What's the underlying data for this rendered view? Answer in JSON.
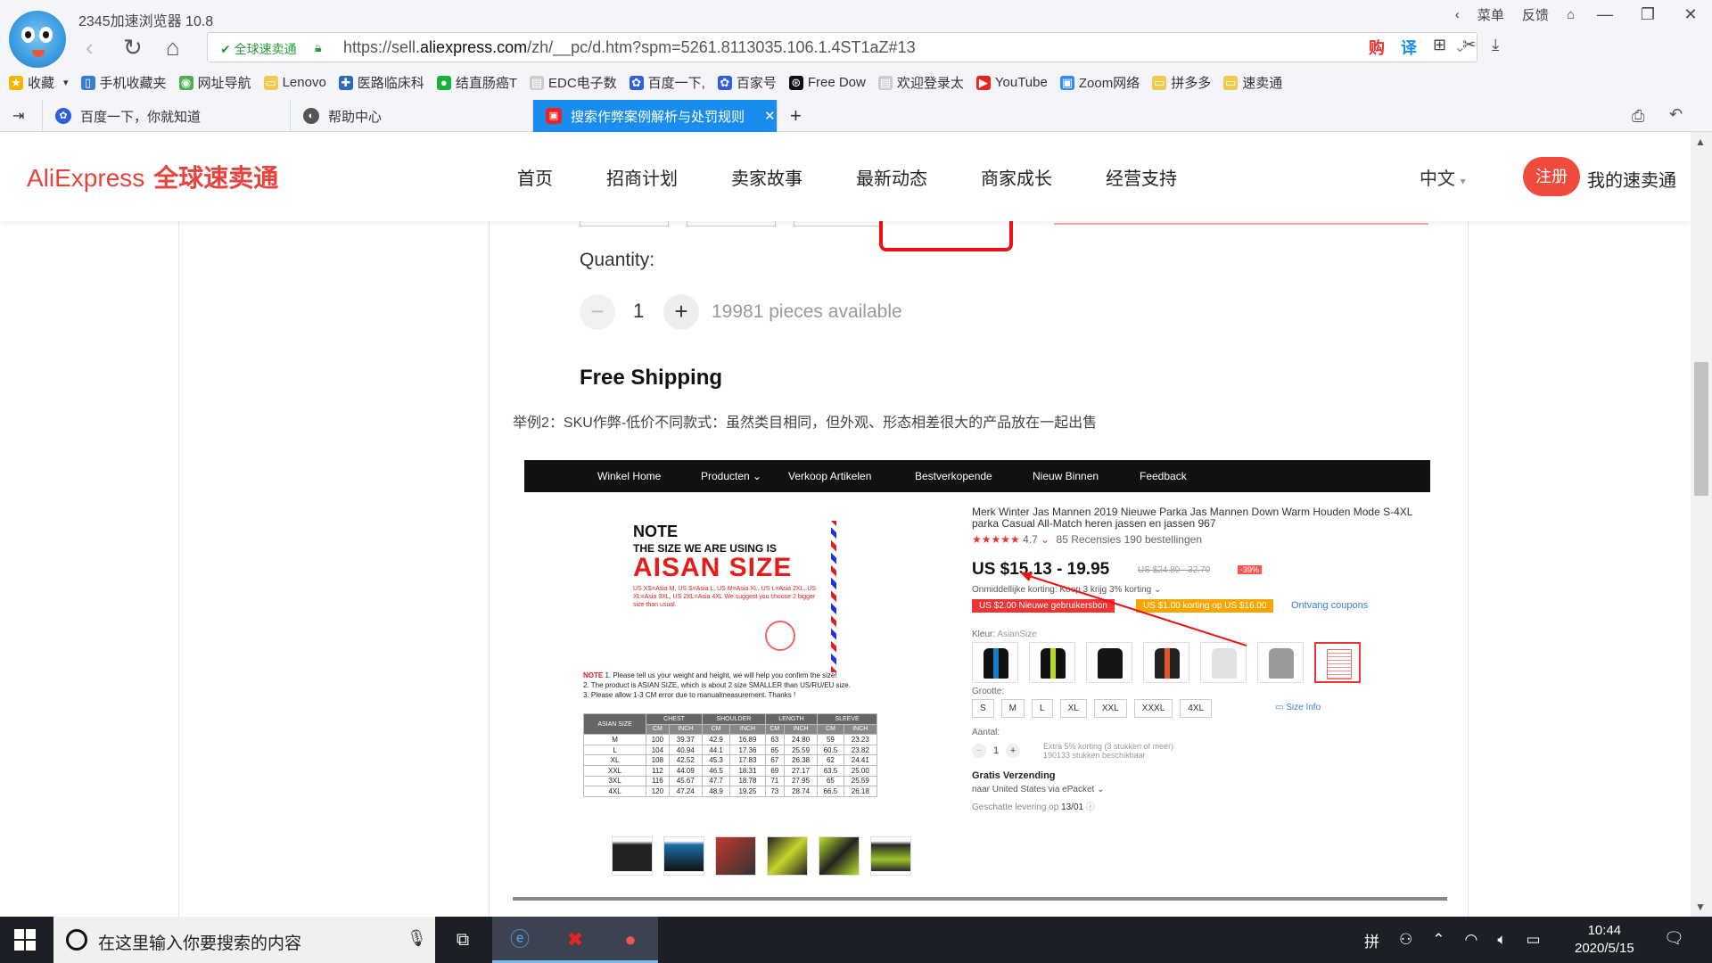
{
  "browser": {
    "title": "2345加速浏览器 10.8",
    "menu_label": "菜单",
    "feedback_label": "反馈",
    "secure_label": "全球速卖通",
    "url_prefix": "https://sell.",
    "url_domain": "aliexpress.com",
    "url_suffix": "/zh/__pc/d.htm?spm=5261.8113035.106.1.4ST1aZ#13",
    "bookmarks": [
      "收藏",
      "手机收藏夹",
      "网址导航",
      "Lenovo",
      "医路临床科",
      "结直肠癌T",
      "EDC电子数",
      "百度一下,",
      "百家号",
      "Free Dow",
      "欢迎登录太",
      "YouTube",
      "Zoom网络",
      "拼多多",
      "速卖通"
    ],
    "tabs": [
      {
        "label": "百度一下，你就知道"
      },
      {
        "label": "帮助中心"
      },
      {
        "label": "搜索作弊案例解析与处罚规则",
        "active": true
      }
    ]
  },
  "site": {
    "logo_en": "AliExpress",
    "logo_cn": "全球速卖通",
    "nav": [
      "首页",
      "招商计划",
      "卖家故事",
      "最新动态",
      "商家成长",
      "经营支持"
    ],
    "lang": "中文",
    "register": "注册",
    "my": "我的速卖通"
  },
  "product_top": {
    "quantity_label": "Quantity:",
    "qty": "1",
    "available": "19981 pieces available",
    "free_shipping": "Free Shipping"
  },
  "example_text": "举例2：SKU作弊-低价不同款式：虽然类目相同，但外观、形态相差很大的产品放在一起出售",
  "inner": {
    "nav": [
      "Winkel Home",
      "Producten ⌄",
      "Verkoop Artikelen",
      "Bestverkopende",
      "Nieuw Binnen",
      "Feedback"
    ],
    "note_title": "NOTE",
    "note_sub": "THE SIZE WE ARE USING IS",
    "note_big": "AISAN SIZE",
    "note_small": "US XS=Asia M, US S=Asia L, US M=Asia XL, US L=Asia 2XL, US XL=Asia 3XL, US 2XL=Asia 4XL We suggest you choose 2 bigger size than usual.",
    "notes_1": "1. Please tell us your weight and height, we will help you confirm the size!",
    "notes_2": "2. The product is ASIAN SIZE, which is about 2 size SMALLER than US/RU/EU size.",
    "notes_3": "3. Please allow 1-3 CM error due to manualmeasurement.  Thanks !",
    "size_table": {
      "headers": [
        "ASIAN SIZE",
        "CHEST",
        "SHOULDER",
        "LENGTH",
        "SLEEVE"
      ],
      "units": [
        "CM",
        "INCH",
        "CM",
        "INCH",
        "CM",
        "INCH",
        "CM",
        "INCH"
      ],
      "rows": [
        [
          "M",
          "100",
          "39.37",
          "42.9",
          "16.89",
          "63",
          "24.80",
          "59",
          "23.23"
        ],
        [
          "L",
          "104",
          "40.94",
          "44.1",
          "17.36",
          "65",
          "25.59",
          "60.5",
          "23.82"
        ],
        [
          "XL",
          "108",
          "42.52",
          "45.3",
          "17.83",
          "67",
          "26.38",
          "62",
          "24.41"
        ],
        [
          "XXL",
          "112",
          "44.09",
          "46.5",
          "18.31",
          "69",
          "27.17",
          "63.5",
          "25.00"
        ],
        [
          "3XL",
          "116",
          "45.67",
          "47.7",
          "18.78",
          "71",
          "27.95",
          "65",
          "25.59"
        ],
        [
          "4XL",
          "120",
          "47.24",
          "48.9",
          "19.25",
          "73",
          "28.74",
          "66.5",
          "26.18"
        ]
      ]
    },
    "title": "Merk Winter Jas Mannen 2019 Nieuwe Parka Jas Mannen Down Warm Houden Mode S-4XL parka Casual All-Match heren jassen en jassen 967",
    "rating": "4.7",
    "reviews": "85 Recensies   190 bestellingen",
    "price": "US $15.13 - 19.95",
    "old_price": "US $24.80 - 32.70",
    "discount": "-39%",
    "instant": "Onmiddellijke korting: Koop 3 krijg 3% korting ⌄",
    "coupon1": "US $2.00 Nieuwe gebruikersbon",
    "coupon2": "US $1.00 korting op US $16.00",
    "coupon3": "Ontvang coupons",
    "kleur_label": "Kleur:",
    "kleur_value": "AsianSize",
    "grootte_label": "Grootte:",
    "sizes": [
      "S",
      "M",
      "L",
      "XL",
      "XXL",
      "XXXL",
      "4XL"
    ],
    "size_info": "Size Info",
    "aantal_label": "Aantal:",
    "aantal_qty": "1",
    "extra_1": "Extra 5% korting (3 stukken of meer)",
    "extra_2": "190133 stukken beschikbaar",
    "gratis": "Gratis Verzending",
    "via": "naar United States via ePacket ⌄",
    "levering_label": "Geschatte levering op",
    "levering_date": "13/01"
  },
  "colors": {
    "accent_red": "#e8433c",
    "tab_blue": "#1a8cf0",
    "secure_green": "#2a9a3c"
  },
  "taskbar": {
    "search_placeholder": "在这里输入你要搜索的内容",
    "time": "10:44",
    "date": "2020/5/15"
  }
}
